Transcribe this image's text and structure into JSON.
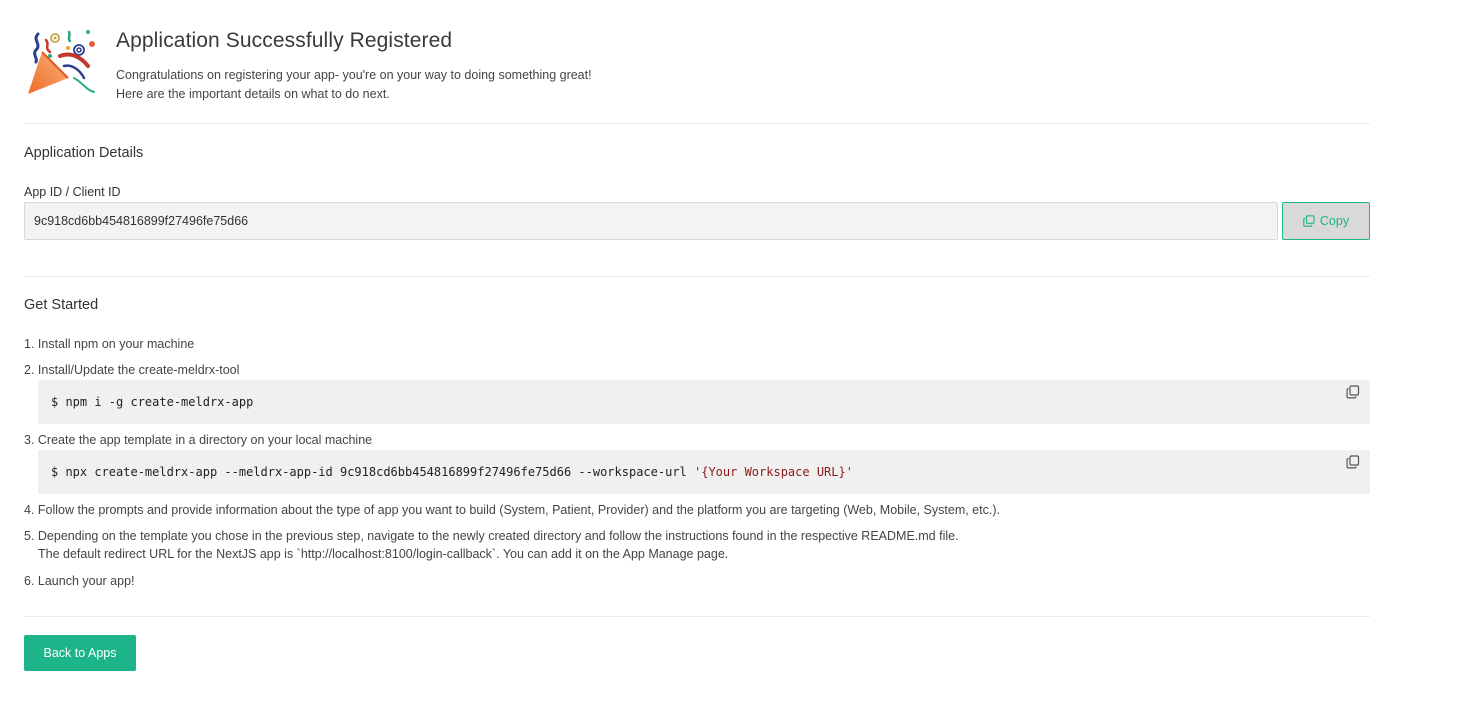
{
  "header": {
    "title": "Application Successfully Registered",
    "subtitle_line1": "Congratulations on registering your app- you're on your way to doing something great!",
    "subtitle_line2": "Here are the important details on what to do next.",
    "logo_icon": "party-popper-icon"
  },
  "details": {
    "section_title": "Application Details",
    "app_id_label": "App ID / Client ID",
    "app_id_value": "9c918cd6bb454816899f27496fe75d66",
    "copy_label": "Copy"
  },
  "get_started": {
    "section_title": "Get Started",
    "step1": "1. Install npm on your machine",
    "step2": "2. Install/Update the create-meldrx-tool",
    "code1": "$ npm i -g create-meldrx-app",
    "step3": "3. Create the app template in a directory on your local machine",
    "code2_prefix": "$ npx create-meldrx-app --meldrx-app-id 9c918cd6bb454816899f27496fe75d66 --workspace-url ",
    "code2_string": "'{Your Workspace URL}'",
    "step4": "4. Follow the prompts and provide information about the type of app you want to build (System, Patient, Provider) and the platform you are targeting (Web, Mobile, System, etc.).",
    "step5_line1": "5. Depending on the template you chose in the previous step, navigate to the newly created directory and follow the instructions found in the respective README.md file.",
    "step5_line2": "The default redirect URL for the NextJS app is `http://localhost:8100/login-callback`. You can add it on the App Manage page.",
    "step6": "6. Launch your app!"
  },
  "footer": {
    "back_label": "Back to Apps"
  },
  "colors": {
    "accent": "#1eb489",
    "code_bg": "#f0f0f0",
    "input_bg": "#f3f3f3"
  }
}
